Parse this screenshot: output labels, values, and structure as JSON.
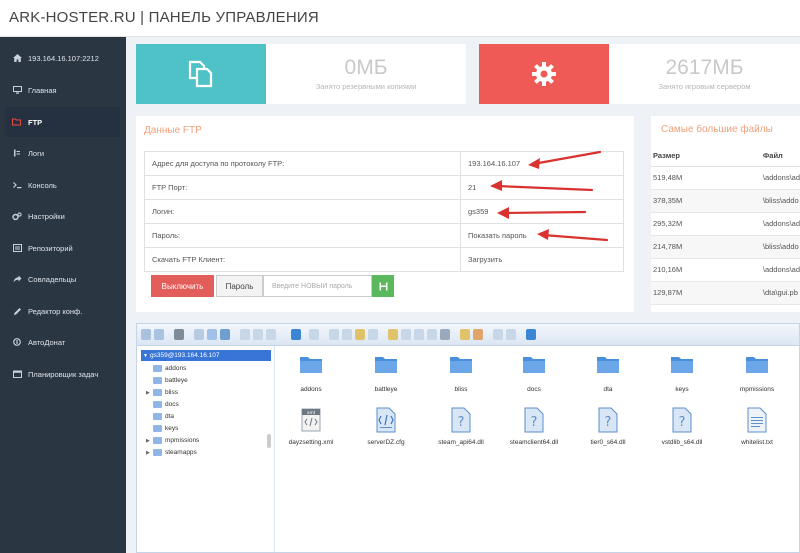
{
  "header": {
    "title": "ARK-HOSTER.RU | ПАНЕЛЬ УПРАВЛЕНИЯ"
  },
  "sidebar": {
    "items": [
      {
        "label": "193.164.16.107:2212",
        "icon": "home-icon"
      },
      {
        "label": "Главная",
        "icon": "monitor-icon"
      },
      {
        "label": "FTP",
        "icon": "folder-open-icon",
        "active": true
      },
      {
        "label": "Логи",
        "icon": "log-icon"
      },
      {
        "label": "Консоль",
        "icon": "terminal-icon"
      },
      {
        "label": "Настройки",
        "icon": "gears-icon"
      },
      {
        "label": "Репозиторий",
        "icon": "repository-icon"
      },
      {
        "label": "Совладельцы",
        "icon": "share-icon"
      },
      {
        "label": "Редактор конф.",
        "icon": "pencil-icon"
      },
      {
        "label": "АвтоДонат",
        "icon": "donate-icon"
      },
      {
        "label": "Планировщик задач",
        "icon": "scheduler-icon"
      }
    ]
  },
  "stats": {
    "backup": {
      "value": "0МБ",
      "label": "Занято резервными копиями",
      "color": "#4ec2c6"
    },
    "server": {
      "value": "2617МБ",
      "label": "Занято игровым сервером",
      "color": "#f05a56"
    }
  },
  "ftp": {
    "title": "Данные FTP",
    "rows": [
      {
        "key": "Адрес для доступа по протоколу FTP:",
        "value": "193.164.16.107"
      },
      {
        "key": "FTP Порт:",
        "value": "21"
      },
      {
        "key": "Логин:",
        "value": "gs359"
      },
      {
        "key": "Пароль:",
        "value": "Показать пароль"
      },
      {
        "key": "Скачать FTP Клиент:",
        "value": "Загрузить"
      }
    ],
    "disable_label": "Выключить",
    "password_label": "Пароль",
    "password_placeholder": "Введите НОВЫЙ пароль"
  },
  "largest": {
    "title": "Самые большие файлы",
    "headers": [
      "Размер",
      "Файл"
    ],
    "rows": [
      [
        "519,48M",
        "\\addons\\ad"
      ],
      [
        "378,35M",
        "\\bliss\\addo"
      ],
      [
        "295,32M",
        "\\addons\\ad"
      ],
      [
        "214,78M",
        "\\bliss\\addo"
      ],
      [
        "210,16M",
        "\\addons\\ad"
      ],
      [
        "129,87M",
        "\\dta\\gui.pb"
      ]
    ]
  },
  "filemanager": {
    "tree": {
      "root": "gs359@193.164.16.107",
      "children": [
        "addons",
        "battleye",
        "bliss",
        "docs",
        "dta",
        "keys",
        "mpmissions",
        "steamapps"
      ]
    },
    "folders": [
      "addons",
      "battleye",
      "bliss",
      "docs",
      "dta",
      "keys",
      "mpmissions"
    ],
    "files": [
      "dayzsetting.xml",
      "serverDZ.cfg",
      "steam_api64.dll",
      "steamclient64.dll",
      "tier0_s64.dll",
      "vstdlib_s64.dll",
      "whitelist.txt"
    ]
  },
  "colors": {
    "accent_red": "#e35d5a",
    "arrow": "#d9322f",
    "teal": "#4ec2c6",
    "sidebar": "#2b3643",
    "save_green": "#5cb85c"
  }
}
